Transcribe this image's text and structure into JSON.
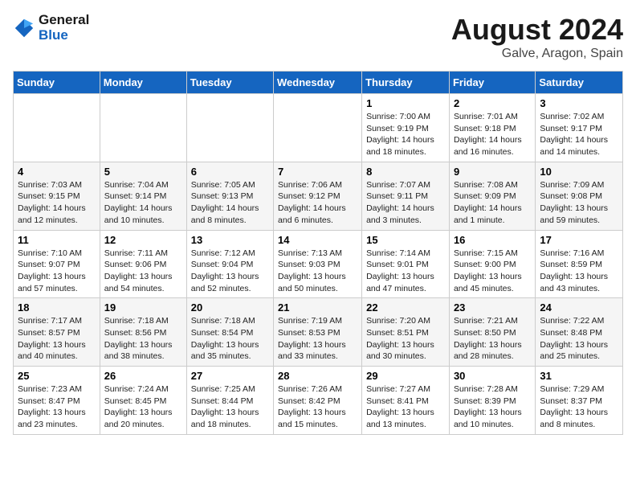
{
  "header": {
    "logo_line1": "General",
    "logo_line2": "Blue",
    "main_title": "August 2024",
    "subtitle": "Galve, Aragon, Spain"
  },
  "weekdays": [
    "Sunday",
    "Monday",
    "Tuesday",
    "Wednesday",
    "Thursday",
    "Friday",
    "Saturday"
  ],
  "weeks": [
    [
      {
        "day": "",
        "info": ""
      },
      {
        "day": "",
        "info": ""
      },
      {
        "day": "",
        "info": ""
      },
      {
        "day": "",
        "info": ""
      },
      {
        "day": "1",
        "info": "Sunrise: 7:00 AM\nSunset: 9:19 PM\nDaylight: 14 hours\nand 18 minutes."
      },
      {
        "day": "2",
        "info": "Sunrise: 7:01 AM\nSunset: 9:18 PM\nDaylight: 14 hours\nand 16 minutes."
      },
      {
        "day": "3",
        "info": "Sunrise: 7:02 AM\nSunset: 9:17 PM\nDaylight: 14 hours\nand 14 minutes."
      }
    ],
    [
      {
        "day": "4",
        "info": "Sunrise: 7:03 AM\nSunset: 9:15 PM\nDaylight: 14 hours\nand 12 minutes."
      },
      {
        "day": "5",
        "info": "Sunrise: 7:04 AM\nSunset: 9:14 PM\nDaylight: 14 hours\nand 10 minutes."
      },
      {
        "day": "6",
        "info": "Sunrise: 7:05 AM\nSunset: 9:13 PM\nDaylight: 14 hours\nand 8 minutes."
      },
      {
        "day": "7",
        "info": "Sunrise: 7:06 AM\nSunset: 9:12 PM\nDaylight: 14 hours\nand 6 minutes."
      },
      {
        "day": "8",
        "info": "Sunrise: 7:07 AM\nSunset: 9:11 PM\nDaylight: 14 hours\nand 3 minutes."
      },
      {
        "day": "9",
        "info": "Sunrise: 7:08 AM\nSunset: 9:09 PM\nDaylight: 14 hours\nand 1 minute."
      },
      {
        "day": "10",
        "info": "Sunrise: 7:09 AM\nSunset: 9:08 PM\nDaylight: 13 hours\nand 59 minutes."
      }
    ],
    [
      {
        "day": "11",
        "info": "Sunrise: 7:10 AM\nSunset: 9:07 PM\nDaylight: 13 hours\nand 57 minutes."
      },
      {
        "day": "12",
        "info": "Sunrise: 7:11 AM\nSunset: 9:06 PM\nDaylight: 13 hours\nand 54 minutes."
      },
      {
        "day": "13",
        "info": "Sunrise: 7:12 AM\nSunset: 9:04 PM\nDaylight: 13 hours\nand 52 minutes."
      },
      {
        "day": "14",
        "info": "Sunrise: 7:13 AM\nSunset: 9:03 PM\nDaylight: 13 hours\nand 50 minutes."
      },
      {
        "day": "15",
        "info": "Sunrise: 7:14 AM\nSunset: 9:01 PM\nDaylight: 13 hours\nand 47 minutes."
      },
      {
        "day": "16",
        "info": "Sunrise: 7:15 AM\nSunset: 9:00 PM\nDaylight: 13 hours\nand 45 minutes."
      },
      {
        "day": "17",
        "info": "Sunrise: 7:16 AM\nSunset: 8:59 PM\nDaylight: 13 hours\nand 43 minutes."
      }
    ],
    [
      {
        "day": "18",
        "info": "Sunrise: 7:17 AM\nSunset: 8:57 PM\nDaylight: 13 hours\nand 40 minutes."
      },
      {
        "day": "19",
        "info": "Sunrise: 7:18 AM\nSunset: 8:56 PM\nDaylight: 13 hours\nand 38 minutes."
      },
      {
        "day": "20",
        "info": "Sunrise: 7:18 AM\nSunset: 8:54 PM\nDaylight: 13 hours\nand 35 minutes."
      },
      {
        "day": "21",
        "info": "Sunrise: 7:19 AM\nSunset: 8:53 PM\nDaylight: 13 hours\nand 33 minutes."
      },
      {
        "day": "22",
        "info": "Sunrise: 7:20 AM\nSunset: 8:51 PM\nDaylight: 13 hours\nand 30 minutes."
      },
      {
        "day": "23",
        "info": "Sunrise: 7:21 AM\nSunset: 8:50 PM\nDaylight: 13 hours\nand 28 minutes."
      },
      {
        "day": "24",
        "info": "Sunrise: 7:22 AM\nSunset: 8:48 PM\nDaylight: 13 hours\nand 25 minutes."
      }
    ],
    [
      {
        "day": "25",
        "info": "Sunrise: 7:23 AM\nSunset: 8:47 PM\nDaylight: 13 hours\nand 23 minutes."
      },
      {
        "day": "26",
        "info": "Sunrise: 7:24 AM\nSunset: 8:45 PM\nDaylight: 13 hours\nand 20 minutes."
      },
      {
        "day": "27",
        "info": "Sunrise: 7:25 AM\nSunset: 8:44 PM\nDaylight: 13 hours\nand 18 minutes."
      },
      {
        "day": "28",
        "info": "Sunrise: 7:26 AM\nSunset: 8:42 PM\nDaylight: 13 hours\nand 15 minutes."
      },
      {
        "day": "29",
        "info": "Sunrise: 7:27 AM\nSunset: 8:41 PM\nDaylight: 13 hours\nand 13 minutes."
      },
      {
        "day": "30",
        "info": "Sunrise: 7:28 AM\nSunset: 8:39 PM\nDaylight: 13 hours\nand 10 minutes."
      },
      {
        "day": "31",
        "info": "Sunrise: 7:29 AM\nSunset: 8:37 PM\nDaylight: 13 hours\nand 8 minutes."
      }
    ]
  ]
}
